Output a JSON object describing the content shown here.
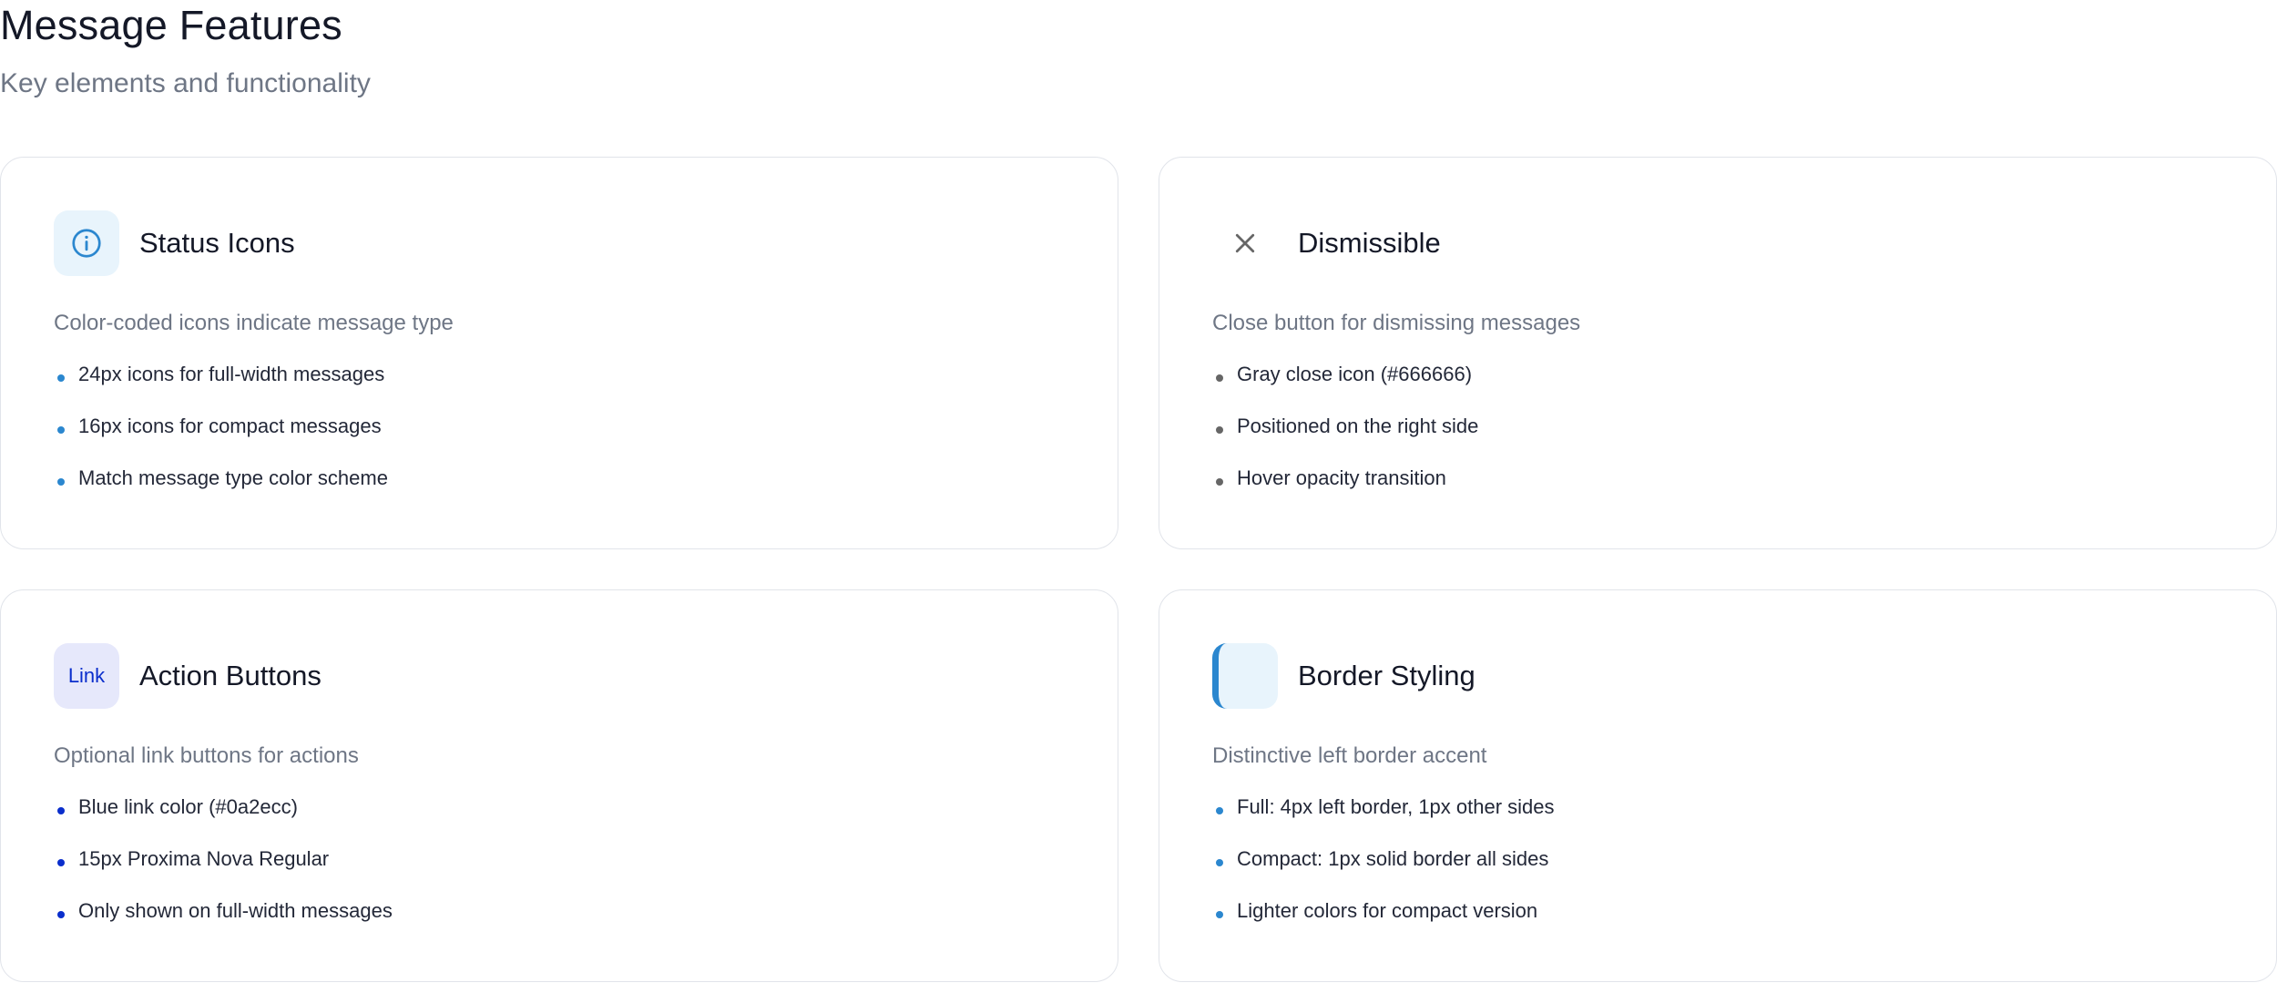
{
  "header": {
    "title": "Message Features",
    "subtitle": "Key elements and functionality"
  },
  "cards": [
    {
      "title": "Status Icons",
      "icon": "info-circle-icon",
      "description": "Color-coded icons indicate message type",
      "bullet_color": "#2b87cf",
      "features": [
        "24px icons for full-width messages",
        "16px icons for compact messages",
        "Match message type color scheme"
      ]
    },
    {
      "title": "Dismissible",
      "icon": "close-icon",
      "description": "Close button for dismissing messages",
      "bullet_color": "#666666",
      "features": [
        "Gray close icon (#666666)",
        "Positioned on the right side",
        "Hover opacity transition"
      ]
    },
    {
      "title": "Action Buttons",
      "icon": "link-icon",
      "icon_label": "Link",
      "description": "Optional link buttons for actions",
      "bullet_color": "#0a2ecc",
      "features": [
        "Blue link color (#0a2ecc)",
        "15px Proxima Nova Regular",
        "Only shown on full-width messages"
      ]
    },
    {
      "title": "Border Styling",
      "icon": "border-accent-icon",
      "description": "Distinctive left border accent",
      "bullet_color": "#2b87cf",
      "features": [
        "Full: 4px left border, 1px other sides",
        "Compact: 1px solid border all sides",
        "Lighter colors for compact version"
      ]
    }
  ],
  "colors": {
    "info_blue": "#2b87cf",
    "link_blue": "#0a2ecc",
    "close_gray": "#666666"
  }
}
